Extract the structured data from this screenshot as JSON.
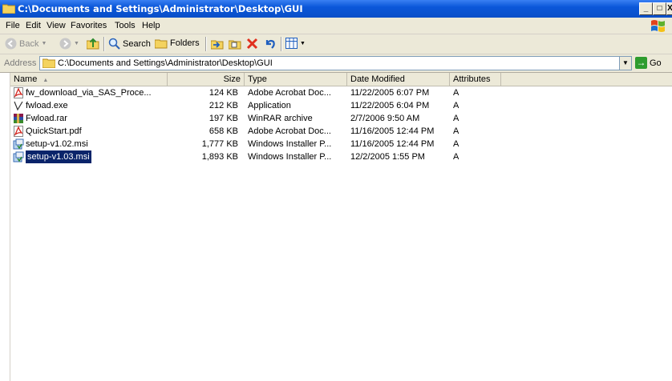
{
  "window": {
    "title": "C:\\Documents and Settings\\Administrator\\Desktop\\GUI",
    "minimize_label": "_",
    "maximize_label": "□",
    "close_label": "X"
  },
  "menu": {
    "items": [
      {
        "label": "File"
      },
      {
        "label": "Edit"
      },
      {
        "label": "View"
      },
      {
        "label": "Favorites"
      },
      {
        "label": "Tools"
      },
      {
        "label": "Help"
      }
    ]
  },
  "toolbar": {
    "back_label": "Back",
    "search_label": "Search",
    "folders_label": "Folders"
  },
  "address": {
    "label": "Address",
    "value": "C:\\Documents and Settings\\Administrator\\Desktop\\GUI",
    "go_label": "Go"
  },
  "list": {
    "columns": [
      "Name",
      "Size",
      "Type",
      "Date Modified",
      "Attributes"
    ],
    "sort_indicator": "▲",
    "rows": [
      {
        "name": "fw_download_via_SAS_Proce...",
        "size": "124 KB",
        "type": "Adobe Acrobat Doc...",
        "date": "11/22/2005 6:07 PM",
        "attr": "A",
        "icon": "pdf-icon"
      },
      {
        "name": "fwload.exe",
        "size": "212 KB",
        "type": "Application",
        "date": "11/22/2005 6:04 PM",
        "attr": "A",
        "icon": "exe-icon"
      },
      {
        "name": "Fwload.rar",
        "size": "197 KB",
        "type": "WinRAR archive",
        "date": "2/7/2006 9:50 AM",
        "attr": "A",
        "icon": "rar-icon"
      },
      {
        "name": "QuickStart.pdf",
        "size": "658 KB",
        "type": "Adobe Acrobat Doc...",
        "date": "11/16/2005 12:44 PM",
        "attr": "A",
        "icon": "pdf-icon"
      },
      {
        "name": "setup-v1.02.msi",
        "size": "1,777 KB",
        "type": "Windows Installer P...",
        "date": "11/16/2005 12:44 PM",
        "attr": "A",
        "icon": "msi-icon"
      },
      {
        "name": "setup-v1.03.msi",
        "size": "1,893 KB",
        "type": "Windows Installer P...",
        "date": "12/2/2005 1:55 PM",
        "attr": "A",
        "icon": "msi-icon",
        "selected": true
      }
    ]
  },
  "colors": {
    "title_bar": "#0a4fc8",
    "chrome": "#ece9d8",
    "selection": "#0a246a"
  }
}
